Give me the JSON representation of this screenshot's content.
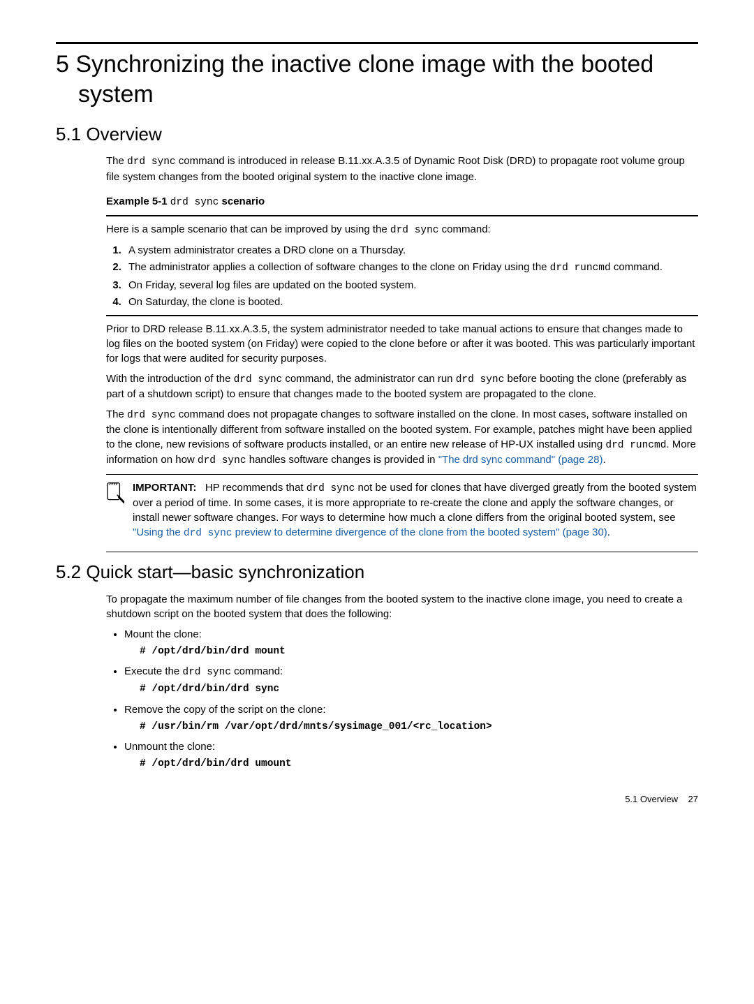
{
  "chapter": {
    "title_line1": "5 Synchronizing the inactive clone image with the booted",
    "title_line2": "system"
  },
  "s51": {
    "heading": "5.1 Overview",
    "intro_a": "The ",
    "intro_code": "drd sync",
    "intro_b": " command is introduced in release B.11.xx.A.3.5 of Dynamic Root Disk (DRD) to propagate root volume group file system changes from the booted original system to the inactive clone image.",
    "example_label_a": "Example 5-1 ",
    "example_label_code": "drd sync",
    "example_label_b": " scenario",
    "scenario_intro_a": "Here is a sample scenario that can be improved by using the ",
    "scenario_intro_code": "drd sync",
    "scenario_intro_b": " command:",
    "steps": {
      "s1": "A system administrator creates a DRD clone on a Thursday.",
      "s2a": "The administrator applies a collection of software changes to the clone on Friday using the ",
      "s2code": "drd runcmd",
      "s2b": " command.",
      "s3": "On Friday, several log files are updated on the booted system.",
      "s4": "On Saturday, the clone is booted."
    },
    "p_prior": "Prior to DRD release B.11.xx.A.3.5, the system administrator needed to take manual actions to ensure that changes made to log files on the booted system (on Friday) were copied to the clone before or after it was booted. This was particularly important for logs that were audited for security purposes.",
    "p_with_a": "With the introduction of the ",
    "p_with_code1": "drd sync",
    "p_with_b": " command, the administrator can run ",
    "p_with_code2": "drd sync",
    "p_with_c": " before booting the clone (preferably as part of a shutdown script) to ensure that changes made to the booted system are propagated to the clone.",
    "p_noprop_a": "The ",
    "p_noprop_code1": "drd sync",
    "p_noprop_b": " command does not propagate changes to software installed on the clone. In most cases, software installed on the clone is intentionally different from software installed on the booted system. For example, patches might have been applied to the clone, new revisions of software products installed, or an entire new release of HP-UX installed using ",
    "p_noprop_code2": "drd runcmd",
    "p_noprop_c": ". More information on how ",
    "p_noprop_code3": "drd sync",
    "p_noprop_d": " handles software changes is provided in ",
    "p_noprop_link": "\"The drd sync command\" (page 28)",
    "p_noprop_e": ".",
    "important_label": "IMPORTANT:",
    "important_a": "HP recommends that ",
    "important_code1": "drd sync",
    "important_b": " not be used for clones that have diverged greatly from the booted system over a period of time. In some cases, it is more appropriate to re-create the clone and apply the software changes, or install newer software changes. For ways to determine how much a clone differs from the original booted system, see ",
    "important_link_a": "\"Using the ",
    "important_link_code": "drd sync",
    "important_link_b": " preview to determine divergence of the clone from the booted system\" (page 30)",
    "important_c": "."
  },
  "s52": {
    "heading": "5.2 Quick start—basic synchronization",
    "intro": "To propagate the maximum number of file changes from the booted system to the inactive clone image, you need to create a shutdown script on the booted system that does the following:",
    "b1_label": "Mount the clone:",
    "b1_cmd": "# /opt/drd/bin/drd mount",
    "b2_label_a": "Execute the ",
    "b2_label_code": "drd sync",
    "b2_label_b": " command:",
    "b2_cmd": "# /opt/drd/bin/drd sync",
    "b3_label": "Remove the copy of the script on the clone:",
    "b3_cmd": "# /usr/bin/rm /var/opt/drd/mnts/sysimage_001/<rc_location>",
    "b4_label": "Unmount the clone:",
    "b4_cmd": "# /opt/drd/bin/drd umount"
  },
  "footer": {
    "left": "5.1 Overview",
    "page": "27"
  }
}
